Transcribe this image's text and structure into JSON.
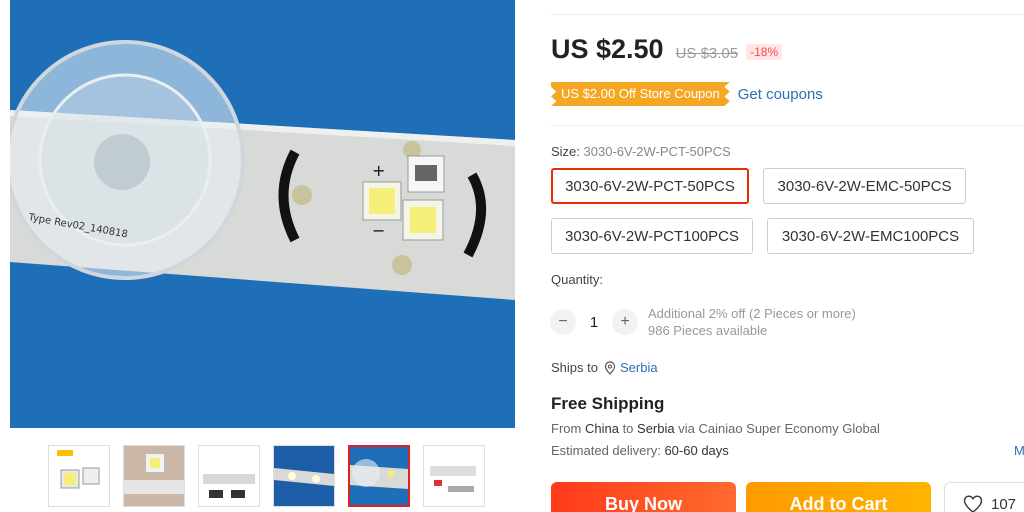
{
  "product": {
    "price": "US $2.50",
    "old_price": "US $3.05",
    "discount": "-18%",
    "coupon_label": "US $2.00 Off Store Coupon",
    "coupon_link": "Get coupons"
  },
  "size": {
    "label": "Size:",
    "selected_value": "3030-6V-2W-PCT-50PCS",
    "options": [
      "3030-6V-2W-PCT-50PCS",
      "3030-6V-2W-EMC-50PCS",
      "3030-6V-2W-PCT100PCS",
      "3030-6V-2W-EMC100PCS"
    ]
  },
  "quantity": {
    "label": "Quantity:",
    "minus": "−",
    "value": "1",
    "plus": "+",
    "discount_note": "Additional 2% off (2 Pieces or more)",
    "available": "986 Pieces available"
  },
  "shipping": {
    "ships_to_label": "Ships to",
    "ships_to_location": "Serbia",
    "title": "Free Shipping",
    "from_prefix": "From",
    "from_country": "China",
    "to_word": "to",
    "to_country": "Serbia",
    "via_text": "via Cainiao Super Economy Global",
    "estimated_label": "Estimated delivery:",
    "estimated_value": "60-60 days",
    "more_link": "M"
  },
  "actions": {
    "buy_now": "Buy Now",
    "add_to_cart": "Add to Cart",
    "wishlist_count": "107"
  },
  "colors": {
    "accent_red": "#e62e04",
    "coupon_orange": "#f5a623",
    "link_blue": "#2e6db8",
    "image_blue": "#1e6fb8"
  },
  "thumbnails": [
    "thumb-1",
    "thumb-2",
    "thumb-3",
    "thumb-4",
    "thumb-5",
    "thumb-6"
  ]
}
